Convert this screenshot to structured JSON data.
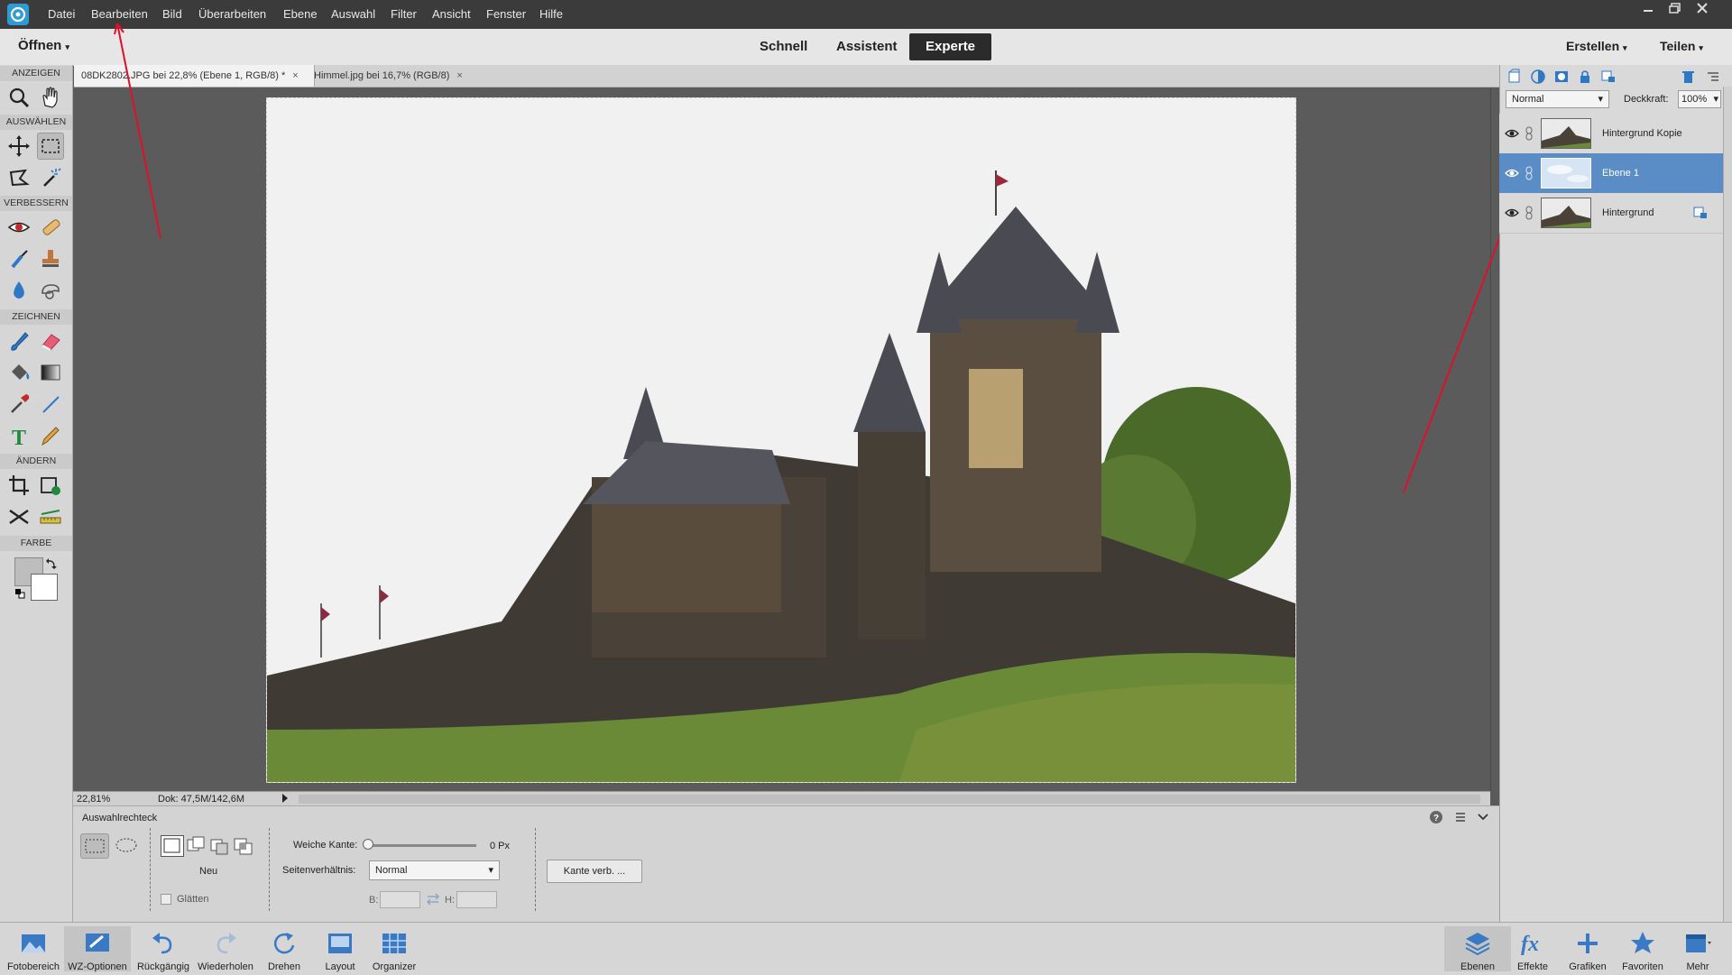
{
  "menubar": {
    "items": [
      "Datei",
      "Bearbeiten",
      "Bild",
      "Überarbeiten",
      "Ebene",
      "Auswahl",
      "Filter",
      "Ansicht",
      "Fenster",
      "Hilfe"
    ]
  },
  "modebar": {
    "open_label": "Öffnen",
    "modes": [
      "Schnell",
      "Assistent",
      "Experte"
    ],
    "active_mode": "Experte",
    "create_label": "Erstellen",
    "share_label": "Teilen"
  },
  "tabs": [
    {
      "label": "08DK2802.JPG bei 22,8% (Ebene 1, RGB/8) *",
      "active": true
    },
    {
      "label": "Himmel.jpg bei 16,7% (RGB/8)",
      "active": false
    }
  ],
  "toolbox": {
    "sections": [
      "ANZEIGEN",
      "AUSWÄHLEN",
      "VERBESSERN",
      "ZEICHNEN",
      "ÄNDERN",
      "FARBE"
    ]
  },
  "status": {
    "zoom": "22,81%",
    "doc": "Dok: 47,5M/142,6M"
  },
  "options": {
    "tool_name": "Auswahlrechteck",
    "new_label": "Neu",
    "smooth_label": "Glätten",
    "feather_label": "Weiche Kante:",
    "feather_value": "0 Px",
    "aspect_label": "Seitenverhältnis:",
    "aspect_value": "Normal",
    "width_label": "B:",
    "height_label": "H:",
    "refine_label": "Kante verb. ..."
  },
  "layers_panel": {
    "blend_mode": "Normal",
    "opacity_label": "Deckkraft:",
    "opacity_value": "100%",
    "layers": [
      {
        "name": "Hintergrund Kopie",
        "selected": false
      },
      {
        "name": "Ebene 1",
        "selected": true
      },
      {
        "name": "Hintergrund",
        "selected": false
      }
    ]
  },
  "bottombar": {
    "left": [
      "Fotobereich",
      "WZ-Optionen",
      "Rückgängig",
      "Wiederholen",
      "Drehen",
      "Layout",
      "Organizer"
    ],
    "right": [
      "Ebenen",
      "Effekte",
      "Grafiken",
      "Favoriten",
      "Mehr"
    ]
  },
  "colors": {
    "accent": "#2e9ad6",
    "selected_layer": "#5a8cc6",
    "annotation_arrow": "#e0102a"
  }
}
